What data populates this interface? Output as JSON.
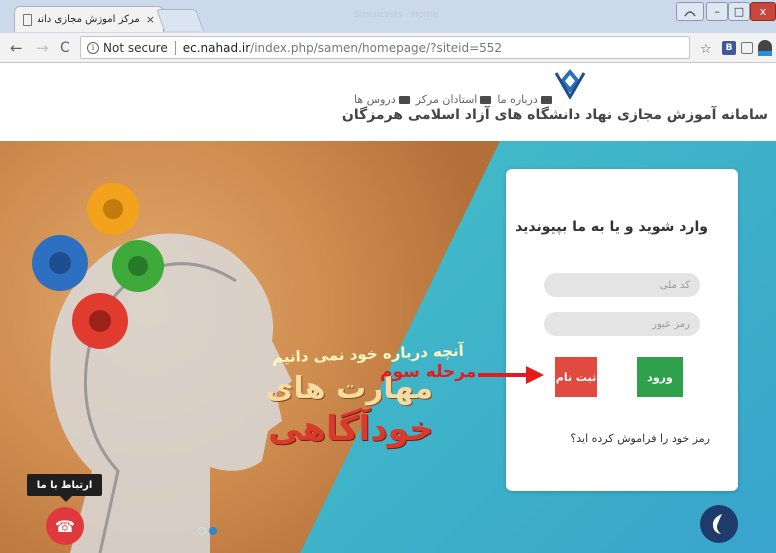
{
  "browser": {
    "tab_title": "مرکز آموزش مجازی دانشگاهیان",
    "tab_close": "×",
    "window_title": "Simulcasts - Home",
    "nav": {
      "back": "←",
      "forward": "→",
      "reload": "C"
    },
    "omnibox": {
      "info": "i",
      "security_label": "Not secure",
      "host": "ec.nahad.ir",
      "path": "/index.php/samen/homepage/?siteid=552"
    },
    "extensions": {
      "b_label": "B"
    },
    "window_buttons": {
      "minimize": "–",
      "maximize": "□",
      "close": "x"
    }
  },
  "site": {
    "title": "سامانه آموزش مجازی نهاد دانشگاه های آزاد اسلامی هرمزگان",
    "nav": [
      {
        "label": "دروس ها",
        "icon": "book-icon"
      },
      {
        "label": "استادان مرکز",
        "icon": "graduation-cap-icon"
      },
      {
        "label": "درباره ما",
        "icon": "monitor-icon"
      }
    ]
  },
  "hero": {
    "promo_line1": "آنچه درباره خود نمی دانیم",
    "promo_line2": "مهارت های",
    "promo_line3": "خودآگاهی",
    "slide_count": 2,
    "active_slide": 2
  },
  "login": {
    "heading": "وارد شوید و یا به ما بپیوندید",
    "national_id_placeholder": "کد ملی",
    "password_placeholder": "رمز عبور",
    "register_label": "ثبت نام",
    "login_label": "ورود",
    "forgot_label": "رمز خود را فراموش کرده اید؟"
  },
  "contact": {
    "tooltip": "ارتباط با ما"
  },
  "annotation": {
    "text": "مرحله سوم",
    "color": "#e11d1d"
  },
  "colors": {
    "register_button": "#e04a3f",
    "login_button": "#2fa14c",
    "phone_button": "#e0393d",
    "hero_background": "#3fc1c4"
  }
}
